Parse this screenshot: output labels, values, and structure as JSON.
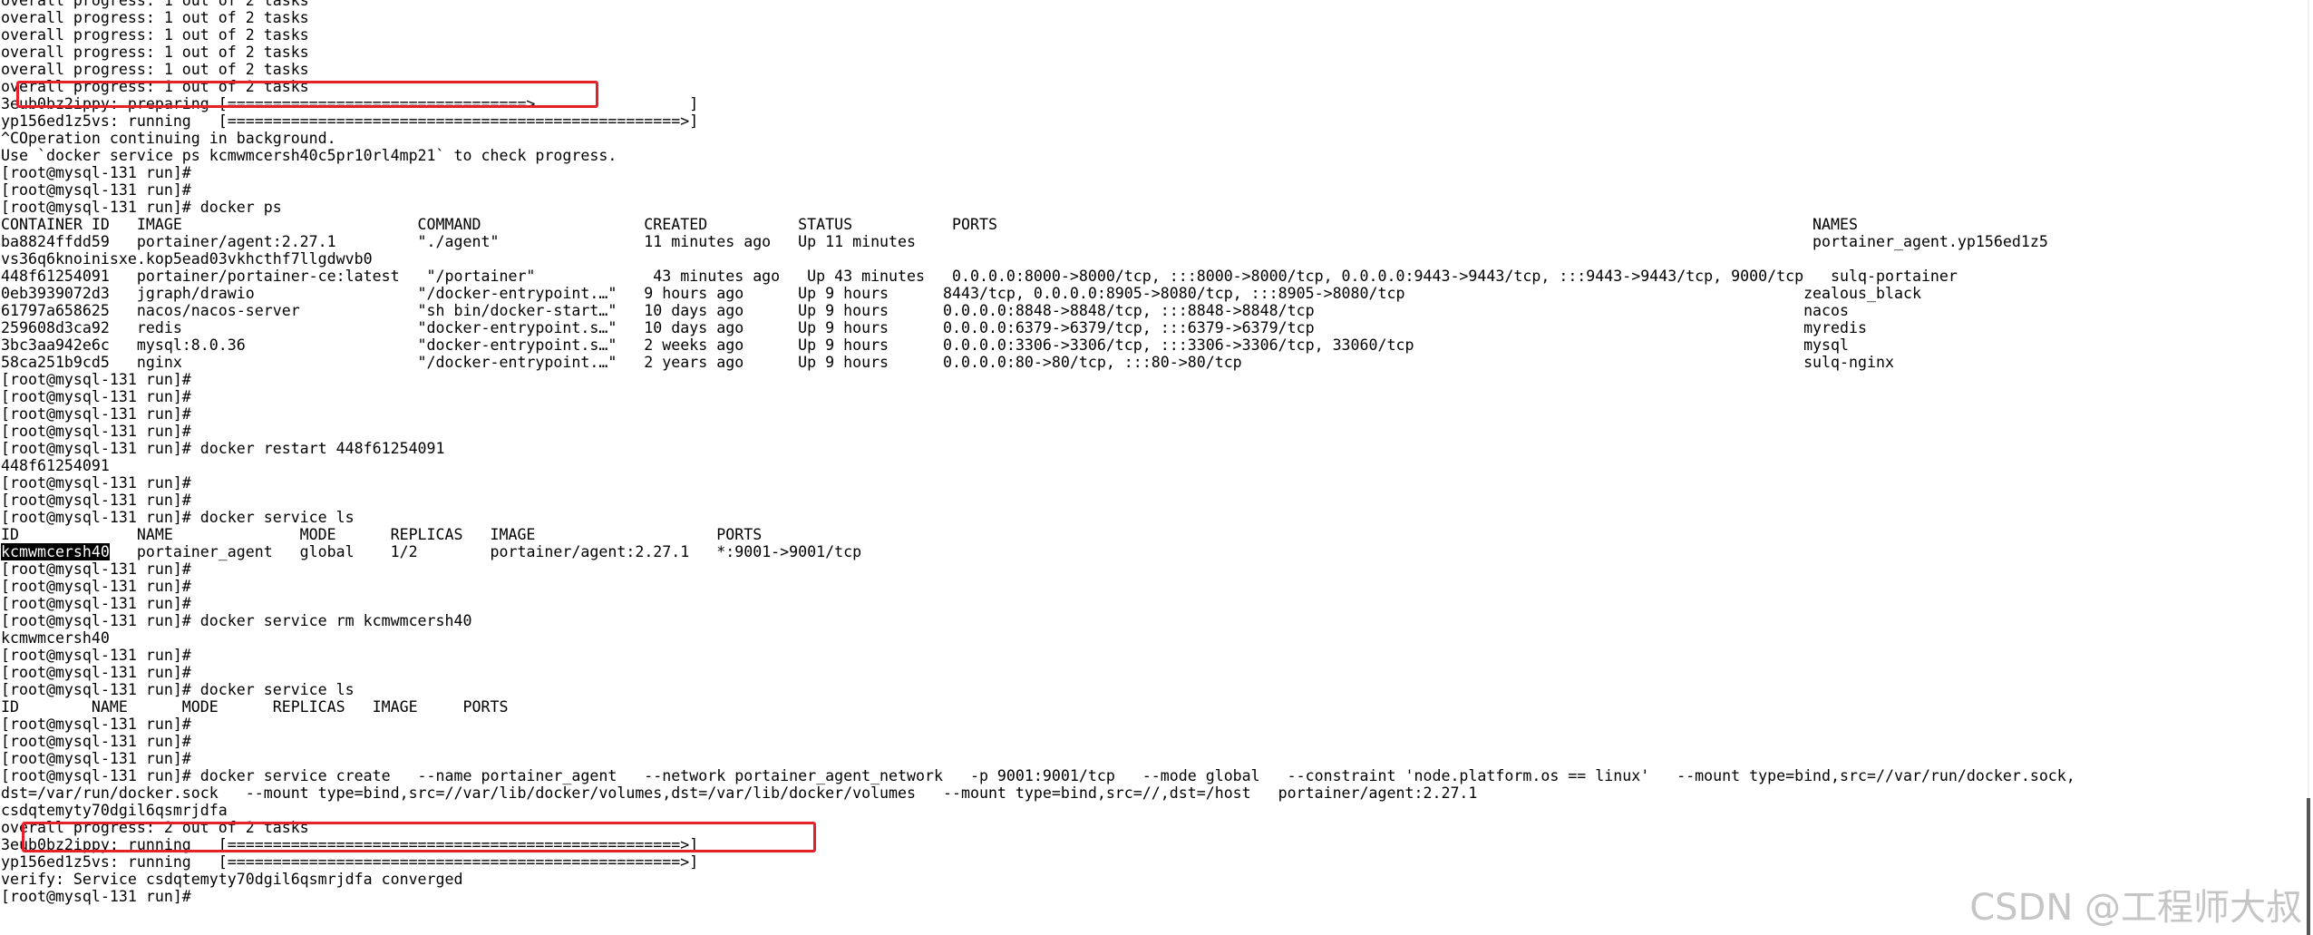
{
  "terminal": {
    "lines": [
      "overall progress: 1 out of 2 tasks",
      "overall progress: 1 out of 2 tasks",
      "overall progress: 1 out of 2 tasks",
      "overall progress: 1 out of 2 tasks",
      "overall progress: 1 out of 2 tasks",
      "overall progress: 1 out of 2 tasks",
      "3eub0bz2ippy: preparing [=================================>                 ]",
      "yp156ed1z5vs: running   [==================================================>]",
      "^COperation continuing in background.",
      "Use `docker service ps kcmwmcersh40c5pr10rl4mp21` to check progress.",
      "[root@mysql-131 run]#",
      "[root@mysql-131 run]#",
      "[root@mysql-131 run]# docker ps",
      "CONTAINER ID   IMAGE                          COMMAND                  CREATED          STATUS           PORTS                                                                                          NAMES",
      "ba8824ffdd59   portainer/agent:2.27.1         \"./agent\"                11 minutes ago   Up 11 minutes                                                                                                   portainer_agent.yp156ed1z5",
      "vs36q6knoinisxe.kop5ead03vkhcthf7llgdwvb0",
      "448f61254091   portainer/portainer-ce:latest   \"/portainer\"             43 minutes ago   Up 43 minutes   0.0.0.0:8000->8000/tcp, :::8000->8000/tcp, 0.0.0.0:9443->9443/tcp, :::9443->9443/tcp, 9000/tcp   sulq-portainer",
      "0eb3939072d3   jgraph/drawio                  \"/docker-entrypoint.…\"   9 hours ago      Up 9 hours      8443/tcp, 0.0.0.0:8905->8080/tcp, :::8905->8080/tcp                                            zealous_black",
      "61797a658625   nacos/nacos-server             \"sh bin/docker-start…\"   10 days ago      Up 9 hours      0.0.0.0:8848->8848/tcp, :::8848->8848/tcp                                                      nacos",
      "259608d3ca92   redis                          \"docker-entrypoint.s…\"   10 days ago      Up 9 hours      0.0.0.0:6379->6379/tcp, :::6379->6379/tcp                                                      myredis",
      "3bc3aa942e6c   mysql:8.0.36                   \"docker-entrypoint.s…\"   2 weeks ago      Up 9 hours      0.0.0.0:3306->3306/tcp, :::3306->3306/tcp, 33060/tcp                                           mysql",
      "58ca251b9cd5   nginx                          \"/docker-entrypoint.…\"   2 years ago      Up 9 hours      0.0.0.0:80->80/tcp, :::80->80/tcp                                                              sulq-nginx",
      "[root@mysql-131 run]#",
      "[root@mysql-131 run]#",
      "[root@mysql-131 run]#",
      "[root@mysql-131 run]#",
      "[root@mysql-131 run]# docker restart 448f61254091",
      "448f61254091",
      "[root@mysql-131 run]#",
      "[root@mysql-131 run]#",
      "[root@mysql-131 run]# docker service ls",
      "ID             NAME              MODE      REPLICAS   IMAGE                    PORTS",
      "",
      "[root@mysql-131 run]#",
      "[root@mysql-131 run]#",
      "[root@mysql-131 run]#",
      "[root@mysql-131 run]# docker service rm kcmwmcersh40",
      "kcmwmcersh40",
      "[root@mysql-131 run]#",
      "[root@mysql-131 run]#",
      "[root@mysql-131 run]# docker service ls",
      "ID        NAME      MODE      REPLICAS   IMAGE     PORTS",
      "[root@mysql-131 run]#",
      "[root@mysql-131 run]#",
      "[root@mysql-131 run]#",
      "[root@mysql-131 run]# docker service create   --name portainer_agent   --network portainer_agent_network   -p 9001:9001/tcp   --mode global   --constraint 'node.platform.os == linux'   --mount type=bind,src=//var/run/docker.sock,",
      "dst=/var/run/docker.sock   --mount type=bind,src=//var/lib/docker/volumes,dst=/var/lib/docker/volumes   --mount type=bind,src=//,dst=/host   portainer/agent:2.27.1",
      "csdqtemyty70dgil6qsmrjdfa",
      "overall progress: 2 out of 2 tasks",
      "3eub0bz2ippy: running   [==================================================>]",
      "yp156ed1z5vs: running   [==================================================>]",
      "verify: Service csdqtemyty70dgil6qsmrjdfa converged",
      "[root@mysql-131 run]#"
    ],
    "service_row": {
      "id": "kcmwmcersh40",
      "rest": "   portainer_agent   global    1/2        portainer/agent:2.27.1   *:9001->9001/tcp"
    }
  },
  "watermark": "CSDN @工程师大叔",
  "colors": {
    "background": "#ffffff",
    "text": "#000000",
    "highlight": "#e8202a",
    "watermark": "#969696"
  }
}
